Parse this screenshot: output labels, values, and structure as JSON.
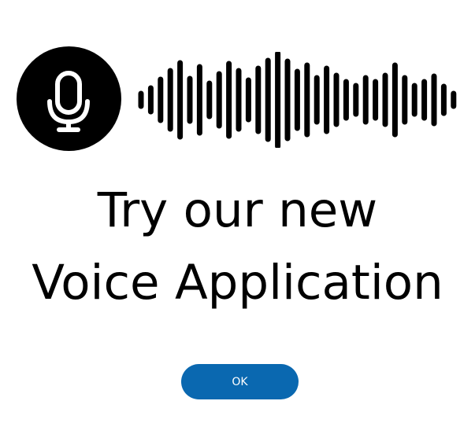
{
  "colors": {
    "icon": "#000000",
    "icon_glyph": "#ffffff",
    "headline": "#000000",
    "button_bg": "#0a68b0",
    "button_text": "#ffffff",
    "background": "#ffffff"
  },
  "icons": {
    "microphone": "microphone-icon",
    "waveform": "audio-waveform-icon"
  },
  "headline": {
    "line1": "Try our new",
    "line2": "Voice Application"
  },
  "dialog": {
    "ok_label": "OK"
  }
}
